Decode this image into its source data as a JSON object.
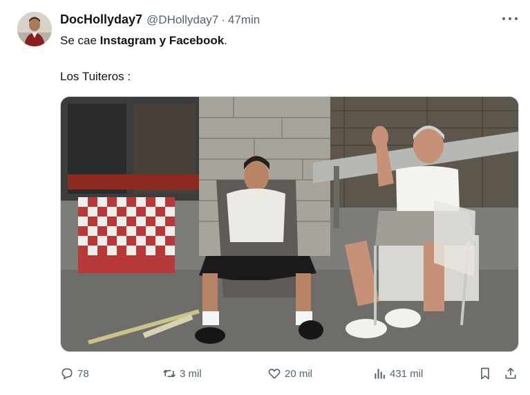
{
  "tweet": {
    "display_name": "DocHollyday7",
    "handle": "@DHollyday7",
    "separator": "·",
    "time": "47min",
    "text_prefix": "Se cae ",
    "text_bold": "Instagram y Facebook",
    "text_suffix": ".",
    "text_line2": "Los Tuiteros :",
    "media_description_icon": "photo"
  },
  "actions": {
    "replies": "78",
    "retweets": "3 mil",
    "likes": "20 mil",
    "views": "431 mil"
  },
  "icons": {
    "reply": "reply-icon",
    "retweet": "retweet-icon",
    "like": "heart-icon",
    "views": "views-icon",
    "bookmark": "bookmark-icon",
    "share": "share-icon",
    "more": "more-icon"
  },
  "colors": {
    "text": "#0f1419",
    "secondary": "#536471",
    "border": "#cfd9de"
  }
}
